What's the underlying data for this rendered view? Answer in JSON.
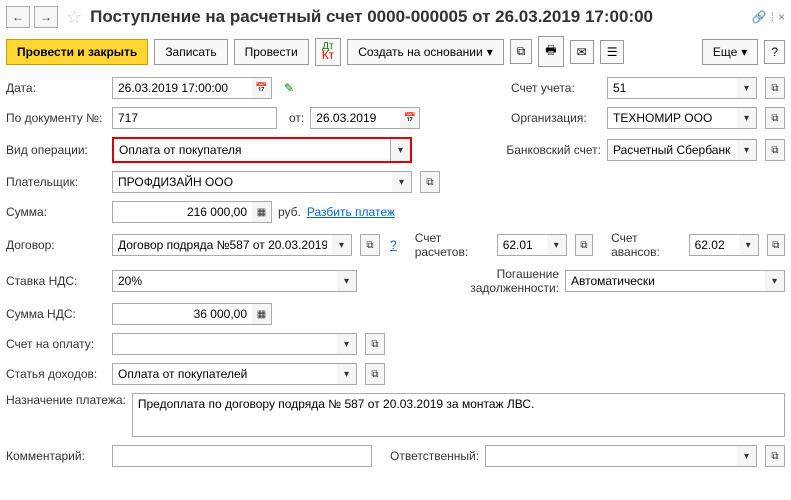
{
  "header": {
    "title": "Поступление на расчетный счет 0000-000005 от 26.03.2019 17:00:00"
  },
  "toolbar": {
    "post_close": "Провести и закрыть",
    "save": "Записать",
    "post": "Провести",
    "create_based": "Создать на основании",
    "more": "Еще"
  },
  "labels": {
    "date": "Дата:",
    "doc_num": "По документу №:",
    "from": "от:",
    "op_type": "Вид операции:",
    "payer": "Плательщик:",
    "sum": "Сумма:",
    "currency": "руб.",
    "split": "Разбить платеж",
    "contract": "Договор:",
    "vat_rate": "Ставка НДС:",
    "vat_sum": "Сумма НДС:",
    "invoice": "Счет на оплату:",
    "income_item": "Статья доходов:",
    "purpose": "Назначение платежа:",
    "comment": "Комментарий:",
    "account": "Счет учета:",
    "org": "Организация:",
    "bank_acc": "Банковский счет:",
    "calc_acc": "Счет расчетов:",
    "advance_acc": "Счет авансов:",
    "debt_repay": "Погашение задолженности:",
    "responsible": "Ответственный:"
  },
  "values": {
    "date": "26.03.2019 17:00:00",
    "doc_num": "717",
    "doc_date": "26.03.2019",
    "op_type": "Оплата от покупателя",
    "payer": "ПРОФДИЗАЙН ООО",
    "sum": "216 000,00",
    "contract": "Договор подряда №587 от 20.03.2019",
    "vat_rate": "20%",
    "vat_sum": "36 000,00",
    "invoice": "",
    "income_item": "Оплата от покупателей",
    "purpose": "Предоплата по договору подряда № 587 от 20.03.2019 за монтаж ЛВС.",
    "comment": "",
    "account": "51",
    "org": "ТЕХНОМИР ООО",
    "bank_acc": "Расчетный Сбербанк руб.",
    "calc_acc": "62.01",
    "advance_acc": "62.02",
    "debt_repay": "Автоматически",
    "responsible": ""
  }
}
